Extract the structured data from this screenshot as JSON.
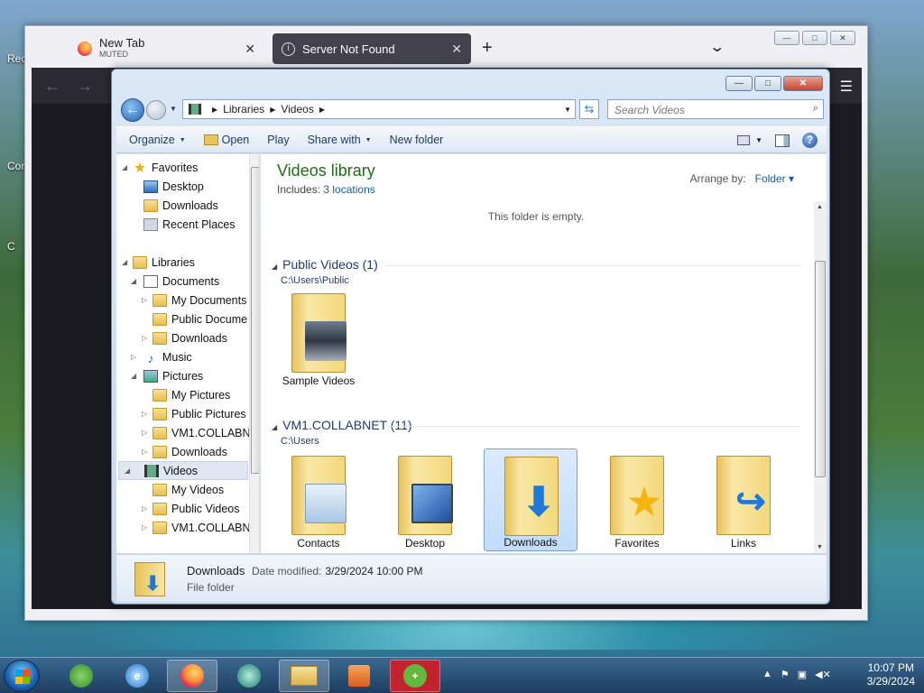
{
  "desktop": {
    "icons": [
      "Rec",
      "Cor",
      "C"
    ]
  },
  "firefox": {
    "tabs": [
      {
        "title": "New Tab",
        "sub": "MUTED",
        "close": "✕"
      },
      {
        "title": "Server Not Found",
        "close": "✕"
      }
    ],
    "new_tab": "+",
    "tab_list": "⌄",
    "win_min": "—",
    "win_max": "□",
    "win_close": "✕",
    "back": "←",
    "forward": "→",
    "menu": "☰"
  },
  "explorer": {
    "address": {
      "crumbs": [
        "Libraries",
        "Videos"
      ]
    },
    "search_placeholder": "Search Videos",
    "toolbar": {
      "organize": "Organize",
      "open": "Open",
      "play": "Play",
      "share": "Share with",
      "new_folder": "New folder"
    },
    "nav": {
      "favorites": "Favorites",
      "desktop": "Desktop",
      "downloads": "Downloads",
      "recent": "Recent Places",
      "libraries": "Libraries",
      "documents": "Documents",
      "my_documents": "My Documents",
      "public_documents": "Public Docume",
      "doc_downloads": "Downloads",
      "music": "Music",
      "pictures": "Pictures",
      "my_pictures": "My Pictures",
      "public_pictures": "Public Pictures",
      "vm1_pics": "VM1.COLLABN",
      "pic_downloads": "Downloads",
      "videos": "Videos",
      "my_videos": "My Videos",
      "public_videos": "Public Videos",
      "vm1_videos": "VM1.COLLABN"
    },
    "content": {
      "title": "Videos library",
      "includes": "Includes:",
      "locations": "3 locations",
      "arrange_by": "Arrange by:",
      "arrange_value": "Folder",
      "empty": "This folder is empty.",
      "group1": {
        "name": "Public Videos (1)",
        "path": "C:\\Users\\Public"
      },
      "group2": {
        "name": "VM1.COLLABNET (11)",
        "path": "C:\\Users"
      },
      "items": [
        "Sample Videos",
        "Contacts",
        "Desktop",
        "Downloads",
        "Favorites",
        "Links"
      ]
    },
    "details": {
      "name": "Downloads",
      "date_label": "Date modified:",
      "date": "3/29/2024 10:00 PM",
      "type": "File folder"
    }
  },
  "taskbar": {
    "time": "10:07 PM",
    "date": "3/29/2024"
  }
}
